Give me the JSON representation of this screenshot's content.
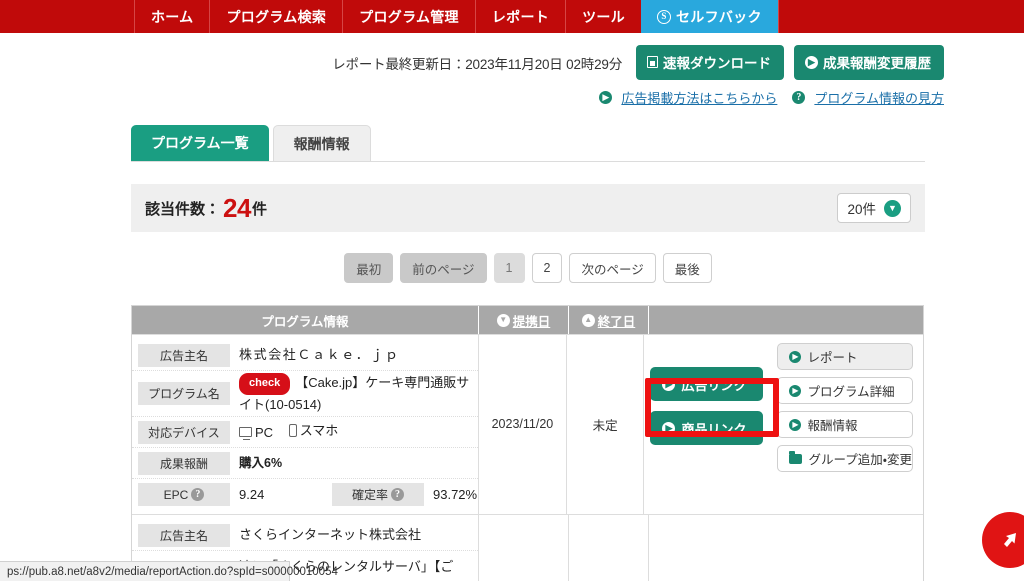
{
  "globalnav": {
    "items": [
      {
        "label": "ホーム",
        "id": "home"
      },
      {
        "label": "プログラム検索",
        "id": "program-search"
      },
      {
        "label": "プログラム管理",
        "id": "program-manage"
      },
      {
        "label": "レポート",
        "id": "report"
      },
      {
        "label": "ツール",
        "id": "tool"
      }
    ],
    "selfback": {
      "label": "セルフバック",
      "badge": "S"
    },
    "background_color": "#c00a0a",
    "selfback_color": "#29a8dd"
  },
  "report_header": {
    "last_updated_label": "レポート最終更新日：2023年11月20日 02時29分",
    "download_button": "速報ダウンロード",
    "history_button": "成果報酬変更履歴",
    "link_ad_method": "広告掲載方法はこちらから",
    "link_program_info": "プログラム情報の見方"
  },
  "tabs": [
    {
      "label": "プログラム一覧",
      "active": true
    },
    {
      "label": "報酬情報",
      "active": false
    }
  ],
  "count_bar": {
    "label": "該当件数：",
    "number": "24",
    "unit": "件",
    "per_page": "20件"
  },
  "pagination": {
    "first": "最初",
    "prev": "前のページ",
    "page1": "1",
    "page2": "2",
    "next": "次のページ",
    "last": "最後"
  },
  "table": {
    "headers": {
      "program_info": "プログラム情報",
      "partner_date": "提携日",
      "end_date": "終了日",
      "actions": ""
    },
    "rows": [
      {
        "advertiser_label": "広告主名",
        "advertiser_value": "株式会社Ｃａｋｅ．ｊｐ",
        "program_label": "プログラム名",
        "program_badge": "check",
        "program_value": "【Cake.jp】ケーキ専門通販サイト(10-0514)",
        "device_label": "対応デバイス",
        "device_pc": "PC",
        "device_sp": "スマホ",
        "reward_label": "成果報酬",
        "reward_value": "購入6%",
        "epc_label": "EPC",
        "epc_value": "9.24",
        "rate_label": "確定率",
        "rate_value": "93.72%",
        "partner_date": "2023/11/20",
        "end_date": "未定",
        "btn_ad_link": "広告リンク",
        "btn_product_link": "商品リンク",
        "btn_report": "レポート",
        "btn_program_detail": "プログラム詳細",
        "btn_reward_info": "報酬情報",
        "btn_group_edit": "グループ追加・変更"
      },
      {
        "advertiser_label": "広告主名",
        "advertiser_value": "さくらインターネット株式会社",
        "program_value": "適に「さくらのレンタルサーバ」【ご"
      }
    ]
  },
  "status_bar": {
    "url": "ps://pub.a8.net/a8v2/media/reportAction.do?spId=s00000010054"
  },
  "highlight": {
    "target": "広告リンク",
    "color": "#ee1111"
  }
}
